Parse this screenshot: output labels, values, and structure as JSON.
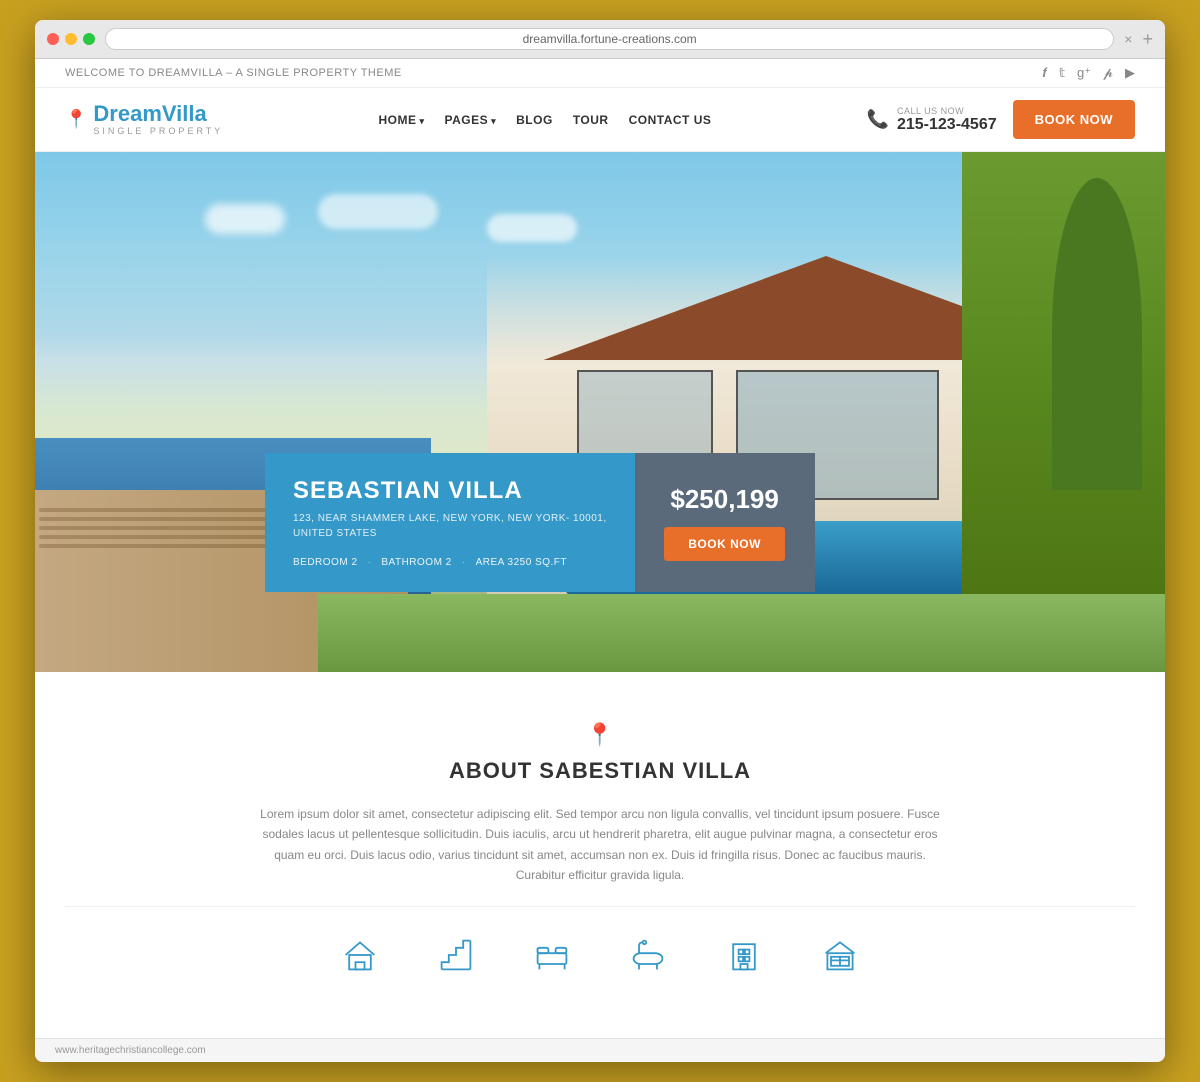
{
  "browser": {
    "url": "dreamvilla.fortune-creations.com",
    "close_btn": "×",
    "new_tab_btn": "+"
  },
  "topbar": {
    "welcome_text": "WELCOME TO DREAMVILLA – A SINGLE PROPERTY THEME",
    "social_icons": [
      "facebook",
      "twitter",
      "google-plus",
      "pinterest",
      "youtube"
    ]
  },
  "navbar": {
    "logo_main": "Dream",
    "logo_accent": "Villa",
    "logo_sub": "SINGLE PROPERTY",
    "nav_links": [
      {
        "label": "HOME",
        "has_arrow": true
      },
      {
        "label": "PAGES",
        "has_arrow": true
      },
      {
        "label": "BLOG",
        "has_arrow": false
      },
      {
        "label": "TOUR",
        "has_arrow": false
      },
      {
        "label": "CONTACT US",
        "has_arrow": false
      }
    ],
    "call_label": "CALL US NOW",
    "call_number": "215-123-4567",
    "book_btn": "BOOK NOW"
  },
  "hero": {
    "property_name": "SEBASTIAN VILLA",
    "address_line1": "123, NEAR SHAMMER LAKE, NEW YORK, NEW YORK- 10001,",
    "address_line2": "UNITED STATES",
    "bedroom": "BEDROOM  2",
    "bathroom": "BATHROOM  2",
    "area": "AREA  3250 SQ.FT",
    "price": "$250,199",
    "book_btn": "BOOK NOW"
  },
  "about": {
    "title": "ABOUT SABESTIAN VILLA",
    "body": "Lorem ipsum dolor sit amet, consectetur adipiscing elit. Sed tempor arcu non ligula convallis, vel tincidunt ipsum posuere. Fusce sodales lacus ut pellentesque sollicitudin. Duis iaculis, arcu ut hendrerit pharetra, elit augue pulvinar magna, a consectetur eros quam eu orci. Duis lacus odio, varius tincidunt sit amet, accumsan non ex. Duis id fringilla risus. Donec ac faucibus mauris. Curabitur efficitur gravida ligula."
  },
  "features": [
    {
      "icon": "house",
      "label": "House"
    },
    {
      "icon": "stairs",
      "label": "Stairs"
    },
    {
      "icon": "bed",
      "label": "Bedroom"
    },
    {
      "icon": "bath",
      "label": "Bathroom"
    },
    {
      "icon": "building",
      "label": "Building"
    },
    {
      "icon": "garage",
      "label": "Garage"
    }
  ],
  "footer": {
    "url": "www.heritagechristiancollege.com"
  },
  "colors": {
    "brand_blue": "#3498c8",
    "cta_orange": "#e86f2a",
    "dark_card": "#5a6a7a",
    "text_dark": "#333333",
    "text_gray": "#888888"
  }
}
